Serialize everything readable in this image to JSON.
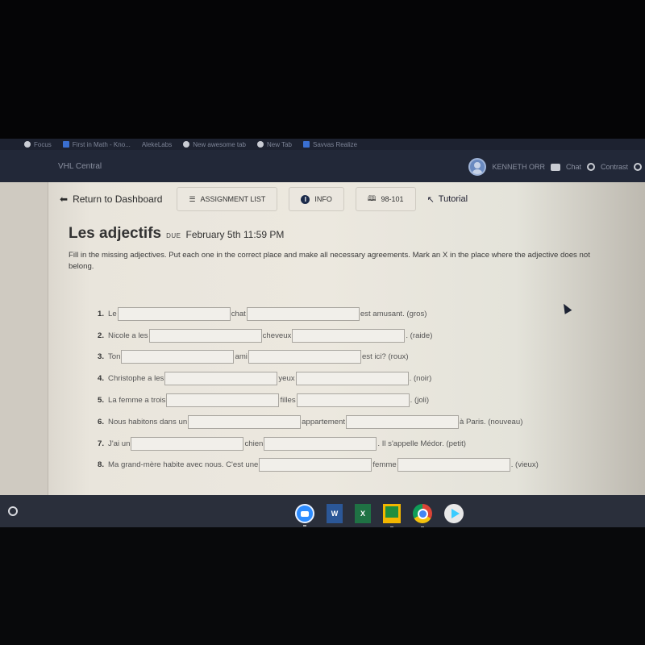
{
  "browser": {
    "bookmarks": [
      {
        "label": "Focus",
        "icon": "globe-icon"
      },
      {
        "label": "First in Math - Kno...",
        "icon": "fm-icon"
      },
      {
        "label": "AlekeLabs",
        "icon": "page-icon"
      },
      {
        "label": "New awesome tab",
        "icon": "globe-icon"
      },
      {
        "label": "New Tab",
        "icon": "globe-icon"
      },
      {
        "label": "Savvas Realize",
        "icon": "savvas-icon"
      }
    ]
  },
  "header": {
    "brand": "VHL Central",
    "user_name": "KENNETH ORR",
    "chat_label": "Chat",
    "contrast_label": "Contrast"
  },
  "nav": {
    "return_label": "Return to Dashboard",
    "assignment_list_label": "ASSIGNMENT LIST",
    "info_label": "INFO",
    "info_glyph": "i",
    "pages_label": "98-101",
    "tutorial_label": "Tutorial"
  },
  "assignment": {
    "title": "Les adjectifs",
    "due_label": "DUE",
    "due_date": "February 5th 11:59 PM",
    "instructions": "Fill in the missing adjectives. Put each one in the correct place and make all necessary agreements. Mark an X in the place where the adjective does not belong.",
    "items": [
      {
        "num": "1.",
        "parts": [
          "Le",
          "chat",
          "est amusant. (gros)"
        ],
        "answers": [
          "",
          ""
        ]
      },
      {
        "num": "2.",
        "parts": [
          "Nicole a les",
          "cheveux",
          ". (raide)"
        ],
        "answers": [
          "",
          ""
        ]
      },
      {
        "num": "3.",
        "parts": [
          "Ton",
          "ami",
          "est ici? (roux)"
        ],
        "answers": [
          "",
          ""
        ]
      },
      {
        "num": "4.",
        "parts": [
          "Christophe a les",
          "yeux",
          ". (noir)"
        ],
        "answers": [
          "",
          ""
        ]
      },
      {
        "num": "5.",
        "parts": [
          "La femme a trois",
          "filles",
          ". (joli)"
        ],
        "answers": [
          "",
          ""
        ]
      },
      {
        "num": "6.",
        "parts": [
          "Nous habitons dans un",
          "appartement",
          "à Paris. (nouveau)"
        ],
        "answers": [
          "",
          ""
        ]
      },
      {
        "num": "7.",
        "parts": [
          "J'ai un",
          "chien",
          ". Il s'appelle Médor. (petit)"
        ],
        "answers": [
          "",
          ""
        ]
      },
      {
        "num": "8.",
        "parts": [
          "Ma grand-mère habite avec nous. C'est une",
          "femme",
          ". (vieux)"
        ],
        "answers": [
          "",
          ""
        ]
      }
    ]
  },
  "taskbar": {
    "apps": [
      {
        "name": "Zoom",
        "glyph": ""
      },
      {
        "name": "Word",
        "glyph": "W"
      },
      {
        "name": "Excel",
        "glyph": "X"
      },
      {
        "name": "Google Classroom",
        "glyph": ""
      },
      {
        "name": "Chrome",
        "glyph": ""
      },
      {
        "name": "Play Store",
        "glyph": ""
      }
    ]
  }
}
